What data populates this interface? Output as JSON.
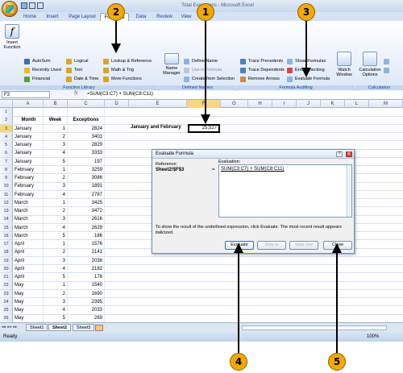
{
  "window": {
    "title": "Total Exceptions - Microsoft Excel"
  },
  "tabs": [
    "Home",
    "Insert",
    "Page Layout",
    "Formulas",
    "Data",
    "Review",
    "View"
  ],
  "active_tab": "Formulas",
  "ribbon": {
    "insert_function": "Insert Function",
    "autosum": "AutoSum",
    "recently_used": "Recently Used",
    "financial": "Financial",
    "logical": "Logical",
    "text": "Text",
    "date_time": "Date & Time",
    "lookup_reference": "Lookup & Reference",
    "math_trig": "Math & Trig",
    "more_functions": "More Functions",
    "function_library": "Function Library",
    "name_manager": "Name Manager",
    "define_name": "Define Name",
    "use_in_formula": "Use in Formula",
    "create_from_selection": "Create from Selection",
    "defined_names": "Defined Names",
    "trace_precedents": "Trace Precedents",
    "trace_dependents": "Trace Dependents",
    "remove_arrows": "Remove Arrows",
    "show_formulas": "Show Formulas",
    "error_checking": "Error Checking",
    "evaluate_formula": "Evaluate Formula",
    "watch_window": "Watch Window",
    "formula_auditing": "Formula Auditing",
    "calculation_options": "Calculation Options",
    "calculation": "Calculation"
  },
  "formula_bar": {
    "name_box": "F3",
    "fx": "fx",
    "formula": "=SUM(C3:C7) + SUM(C8:C11)"
  },
  "columns": [
    "A",
    "B",
    "C",
    "D",
    "E",
    "F",
    "G",
    "H",
    "I",
    "J",
    "K",
    "L",
    "M"
  ],
  "headers": {
    "month": "Month",
    "week": "Week",
    "exceptions": "Exceptions"
  },
  "rows": [
    {
      "r": "1",
      "month": "",
      "week": "",
      "exc": ""
    },
    {
      "r": "2",
      "month": "Month",
      "week": "Week",
      "exc": "Exceptions"
    },
    {
      "r": "3",
      "month": "January",
      "week": "1",
      "exc": "2824"
    },
    {
      "r": "4",
      "month": "January",
      "week": "2",
      "exc": "3401"
    },
    {
      "r": "5",
      "month": "January",
      "week": "3",
      "exc": "2829"
    },
    {
      "r": "6",
      "month": "January",
      "week": "4",
      "exc": "3333"
    },
    {
      "r": "7",
      "month": "January",
      "week": "5",
      "exc": "197"
    },
    {
      "r": "8",
      "month": "February",
      "week": "1",
      "exc": "3259"
    },
    {
      "r": "9",
      "month": "February",
      "week": "2",
      "exc": "3086"
    },
    {
      "r": "10",
      "month": "February",
      "week": "3",
      "exc": "1891"
    },
    {
      "r": "11",
      "month": "February",
      "week": "4",
      "exc": "2787"
    },
    {
      "r": "12",
      "month": "March",
      "week": "1",
      "exc": "3425"
    },
    {
      "r": "13",
      "month": "March",
      "week": "2",
      "exc": "3472"
    },
    {
      "r": "14",
      "month": "March",
      "week": "3",
      "exc": "2616"
    },
    {
      "r": "15",
      "month": "March",
      "week": "4",
      "exc": "2629"
    },
    {
      "r": "16",
      "month": "March",
      "week": "5",
      "exc": "186"
    },
    {
      "r": "17",
      "month": "April",
      "week": "1",
      "exc": "1576"
    },
    {
      "r": "18",
      "month": "April",
      "week": "2",
      "exc": "2141"
    },
    {
      "r": "19",
      "month": "April",
      "week": "3",
      "exc": "2038"
    },
    {
      "r": "20",
      "month": "April",
      "week": "4",
      "exc": "2182"
    },
    {
      "r": "21",
      "month": "April",
      "week": "5",
      "exc": "178"
    },
    {
      "r": "22",
      "month": "May",
      "week": "1",
      "exc": "1540"
    },
    {
      "r": "23",
      "month": "May",
      "week": "2",
      "exc": "1690"
    },
    {
      "r": "24",
      "month": "May",
      "week": "3",
      "exc": "2395"
    },
    {
      "r": "25",
      "month": "May",
      "week": "4",
      "exc": "2033"
    },
    {
      "r": "26",
      "month": "May",
      "week": "5",
      "exc": "269"
    },
    {
      "r": "27",
      "month": "June",
      "week": "1",
      "exc": "1547"
    }
  ],
  "summary": {
    "label": "January and February",
    "value": "25,527"
  },
  "dialog": {
    "title": "Evaluate Formula",
    "help": "?",
    "close_x": "X",
    "reference_label": "Reference:",
    "reference_value": "Sheet2!$F$3",
    "equals": "=",
    "evaluation_label": "Evaluation:",
    "evaluation_value": "SUM(C3:C7) + SUM(C8:C11)",
    "hint": "To show the result of the underlined expression, click Evaluate.  The most recent result appears italicized.",
    "buttons": {
      "evaluate": "Evaluate",
      "step_in": "Step In",
      "step_out": "Step Out",
      "close": "Close"
    }
  },
  "sheet_tabs": [
    "Sheet1",
    "Sheet2",
    "Sheet3"
  ],
  "active_sheet": "Sheet2",
  "status": {
    "mode": "Ready",
    "zoom": "100%"
  },
  "callouts": [
    "1",
    "2",
    "3",
    "4",
    "5"
  ],
  "colors": {
    "callout": "#f2a900",
    "ribbon_text": "#15428b",
    "selected_header": "#f8d682"
  }
}
